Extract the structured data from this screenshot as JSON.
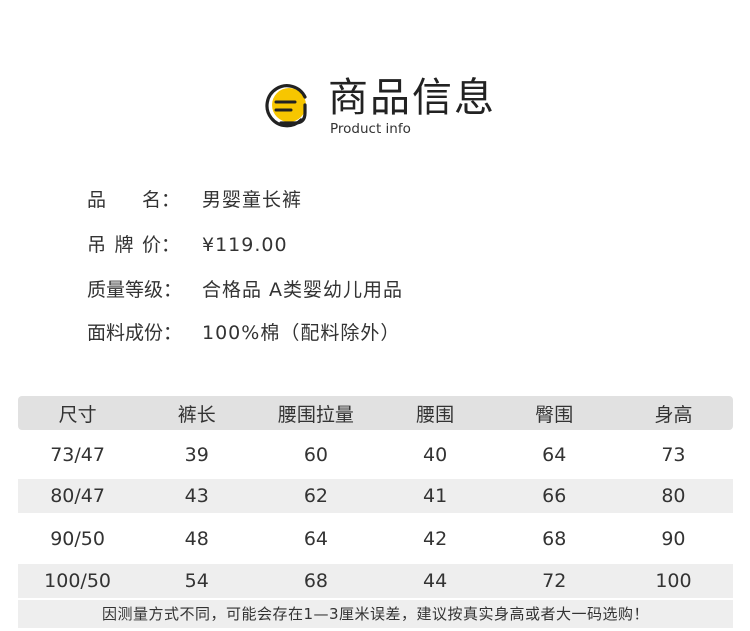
{
  "header": {
    "title": "商品信息",
    "subtitle": "Product info",
    "accent_color": "#f7c600"
  },
  "info": [
    {
      "label_chars": [
        "品",
        "名："
      ],
      "value": "男婴童长裤"
    },
    {
      "label_chars": [
        "吊",
        "牌",
        "价："
      ],
      "value": "¥119.00"
    },
    {
      "label": "质量等级：",
      "value": "合格品 A类婴幼儿用品"
    },
    {
      "label": "面料成份：",
      "value": "100%棉（配料除外）"
    }
  ],
  "table": {
    "columns": [
      "尺寸",
      "裤长",
      "腰围拉量",
      "腰围",
      "臀围",
      "身高"
    ],
    "rows": [
      [
        "73/47",
        "39",
        "60",
        "40",
        "64",
        "73"
      ],
      [
        "80/47",
        "43",
        "62",
        "41",
        "66",
        "80"
      ],
      [
        "90/50",
        "48",
        "64",
        "42",
        "68",
        "90"
      ],
      [
        "100/50",
        "54",
        "68",
        "44",
        "72",
        "100"
      ]
    ]
  },
  "note": "因测量方式不同，可能会存在1—3厘米误差，建议按真实身高或者大一码选购！"
}
